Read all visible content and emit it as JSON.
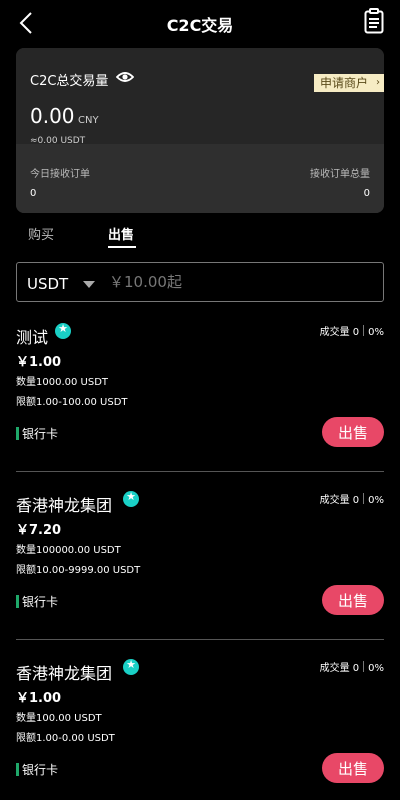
{
  "header": {
    "title": "C2C交易",
    "back_icon": "back-chevron",
    "orders_icon": "clipboard-list"
  },
  "summary": {
    "volume_label": "C2C总交易量",
    "volume_value": "0.00",
    "volume_unit": "CNY",
    "volume_usdt": "≈0.00 USDT",
    "apply_merchant": "申请商户",
    "today_orders_label": "今日接收订单",
    "today_orders_value": "0",
    "total_orders_label": "接收订单总量",
    "total_orders_value": "0"
  },
  "tabs": {
    "buy": "购买",
    "sell": "出售"
  },
  "search": {
    "coin": "USDT",
    "placeholder": "￥10.00起"
  },
  "offers": [
    {
      "name": "测试",
      "volume": "成交量 0",
      "rate": "0%",
      "price": "￥1.00",
      "quantity": "数量1000.00 USDT",
      "limit": "限额1.00-100.00 USDT",
      "payment": "银行卡",
      "action": "出售"
    },
    {
      "name": "香港神龙集团",
      "volume": "成交量 0",
      "rate": "0%",
      "price": "￥7.20",
      "quantity": "数量100000.00 USDT",
      "limit": "限额10.00-9999.00 USDT",
      "payment": "银行卡",
      "action": "出售"
    },
    {
      "name": "香港神龙集团",
      "volume": "成交量 0",
      "rate": "0%",
      "price": "￥1.00",
      "quantity": "数量100.00 USDT",
      "limit": "限额1.00-0.00 USDT",
      "payment": "银行卡",
      "action": "出售"
    }
  ],
  "colors": {
    "sell_button": "#e84867",
    "verified": "#1ad0c6",
    "payment_bar": "#1fa86a",
    "apply_bg": "#f6ecc4"
  }
}
